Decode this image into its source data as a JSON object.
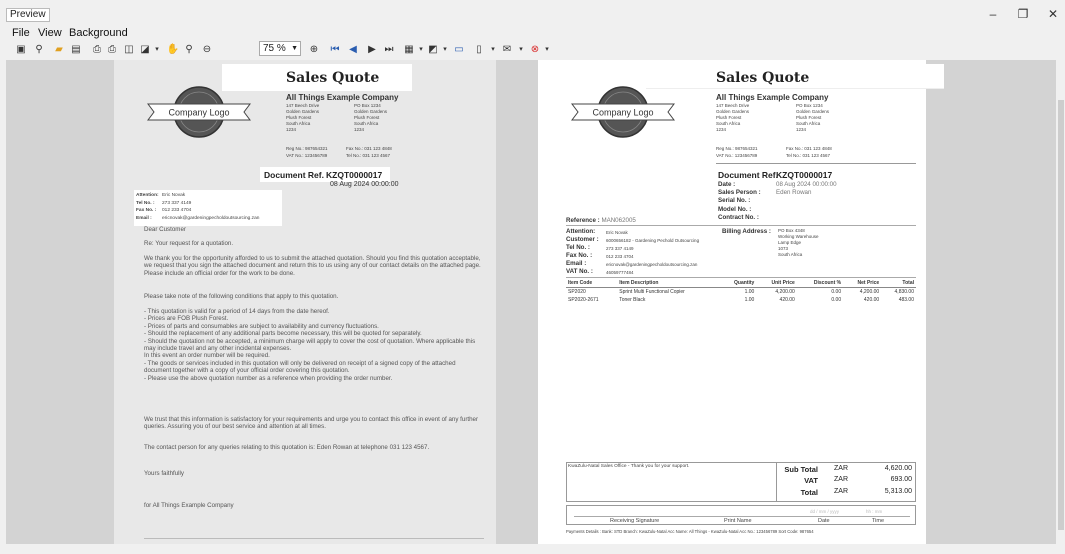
{
  "window": {
    "tab_title": "Preview",
    "minimize": "–",
    "restore": "❐",
    "close": "✕"
  },
  "menu": [
    "File",
    "View",
    "Background"
  ],
  "toolbar": {
    "zoom_value": "75 %"
  },
  "quote": {
    "title": "Sales Quote",
    "company": "All Things Example Company",
    "logo_text": "Company Logo",
    "address_left": [
      "147 Beech Drive",
      "Golden Gardens",
      "Plush Forest",
      "South Africa",
      "1234"
    ],
    "address_right": [
      "PO Box 1234",
      "Golden Gardens",
      "Plush Forest",
      "South Africa",
      "1234"
    ],
    "reg_label": "Reg No.:",
    "reg_no": "987654321",
    "vat_label": "VAT No.:",
    "vat_no": "123456789",
    "fax_label": "Fax No.:",
    "fax_no": "031 123 4848",
    "tel_label": "Tel No.:",
    "tel_no": "031 123 4567",
    "docref_label": "Document Ref.",
    "docref": "KZQT0000017",
    "date": "08 Aug 2024 00:00:00",
    "attention_label": "Attention:",
    "attention": "Eric Novak",
    "cust_tel_label": "Tel No. :",
    "cust_tel": "273 337 4149",
    "cust_fax_label": "Fax No. :",
    "cust_fax": "012 233 4704",
    "email_label": "Email :",
    "email": "ericnovak@gardeningpecholdoutsourcing.zan"
  },
  "letter": {
    "greeting": "Dear Customer",
    "re": "Re: Your request for a quotation.",
    "p1": "We thank you for the opportunity afforded to us to submit the attached quotation. Should you find this quotation acceptable, we request that you sign the attached document and return this to us using any of our contact details on the attached page. Please include an official order for the work to be done.",
    "p2": "Please take note of the following conditions that apply to this quotation.",
    "conditions": [
      "- This quotation is valid for a period of 14 days from the date hereof.",
      "- Prices are FOB Plush Forest.",
      "- Prices of parts and consumables are subject to availability and currency fluctuations.",
      "- Should the replacement of any additional parts become necessary, this will be quoted for separately.",
      "- Should the quotation not be accepted, a minimum charge will apply to cover the cost of quotation. Where applicable this may include travel and any other incidental expenses.",
      "In this event an order number will be required.",
      "- The goods or services included in this quotation will only be delivered on receipt of a signed copy of the attached document together with a copy of your official order covering this quotation.",
      "- Please use the above quotation number as a reference when providing the order number."
    ],
    "p3": "We trust that this information is satisfactory for your requirements and urge you to contact this office in event of any further queries. Assuring you of our best service and attention at all times.",
    "p4": "The contact person for any queries relating to this quotation is: Eden Rowan at telephone 031 123 4567.",
    "closing": "Yours faithfully",
    "signoff": "for All Things Example Company"
  },
  "detail": {
    "date_label": "Date :",
    "sales_person_label": "Sales Person :",
    "sales_person": "Eden Rowan",
    "serial_label": "Serial No. :",
    "model_label": "Model No. :",
    "contract_label": "Contract No. :",
    "reference_label": "Reference :",
    "reference": "MAN062005",
    "customer_label": "Customer :",
    "customer": "6000656182 - Gardening Pechold Outsourcing",
    "vat_label": "VAT No. :",
    "vat": "46059777484",
    "billing_label": "Billing Address :",
    "billing": [
      "PO Box 4348",
      "Working Warehouse",
      "Lamp Edge",
      "1073",
      "South Africa"
    ]
  },
  "items": {
    "headers": [
      "Item Code",
      "Item Description",
      "Quantity",
      "Unit Price",
      "Discount %",
      "Net Price",
      "Total"
    ],
    "rows": [
      [
        "SP2020",
        "Sprint Multi Functional Copier",
        "1.00",
        "4,200.00",
        "0.00",
        "4,200.00",
        "4,830.00"
      ],
      [
        "SP2020-2671",
        "Toner Black",
        "1.00",
        "420.00",
        "0.00",
        "420.00",
        "483.00"
      ]
    ]
  },
  "footer": {
    "office_note": "KwaZulu-Natal Sales Office - Thank you for your support.",
    "subtotal_label": "Sub Total",
    "vat_label": "VAT",
    "total_label": "Total",
    "currency": "ZAR",
    "subtotal": "4,620.00",
    "vat": "693.00",
    "total": "5,313.00",
    "date_hint": "dd / mm / yyyy",
    "time_hint": "hh : mm",
    "sig_labels": [
      "Receiving Signature",
      "Print Name",
      "Date",
      "Time"
    ],
    "payment": "Payments Details : Bank: STD Branch: KwaZulu-Natal Acc Name: All Things - KwaZulu-Natal Acc No.: 123456789 Sort Code: 987654"
  }
}
